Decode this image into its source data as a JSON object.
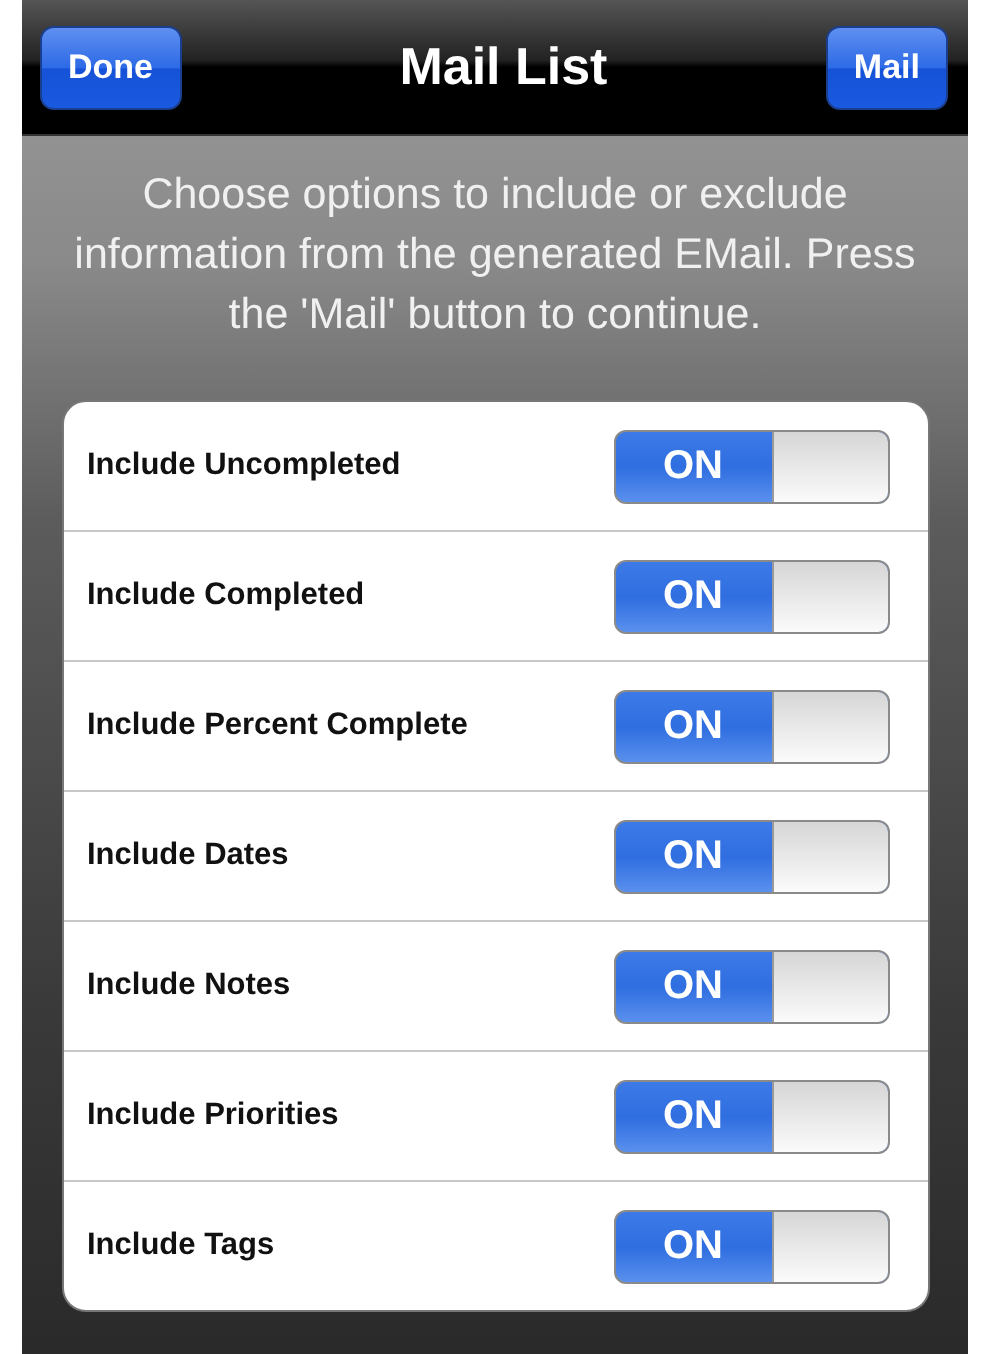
{
  "nav_bar": {
    "title": "Mail List",
    "left_button": "Done",
    "right_button": "Mail"
  },
  "instructions": "Choose options to include or exclude information from the generated EMail. Press the 'Mail' button to continue.",
  "options": [
    {
      "label": "Include Uncompleted",
      "on": true,
      "switch_text": "ON"
    },
    {
      "label": "Include Completed",
      "on": true,
      "switch_text": "ON"
    },
    {
      "label": "Include Percent Complete",
      "on": true,
      "switch_text": "ON"
    },
    {
      "label": "Include Dates",
      "on": true,
      "switch_text": "ON"
    },
    {
      "label": "Include Notes",
      "on": true,
      "switch_text": "ON"
    },
    {
      "label": "Include Priorities",
      "on": true,
      "switch_text": "ON"
    },
    {
      "label": "Include Tags",
      "on": true,
      "switch_text": "ON"
    }
  ]
}
